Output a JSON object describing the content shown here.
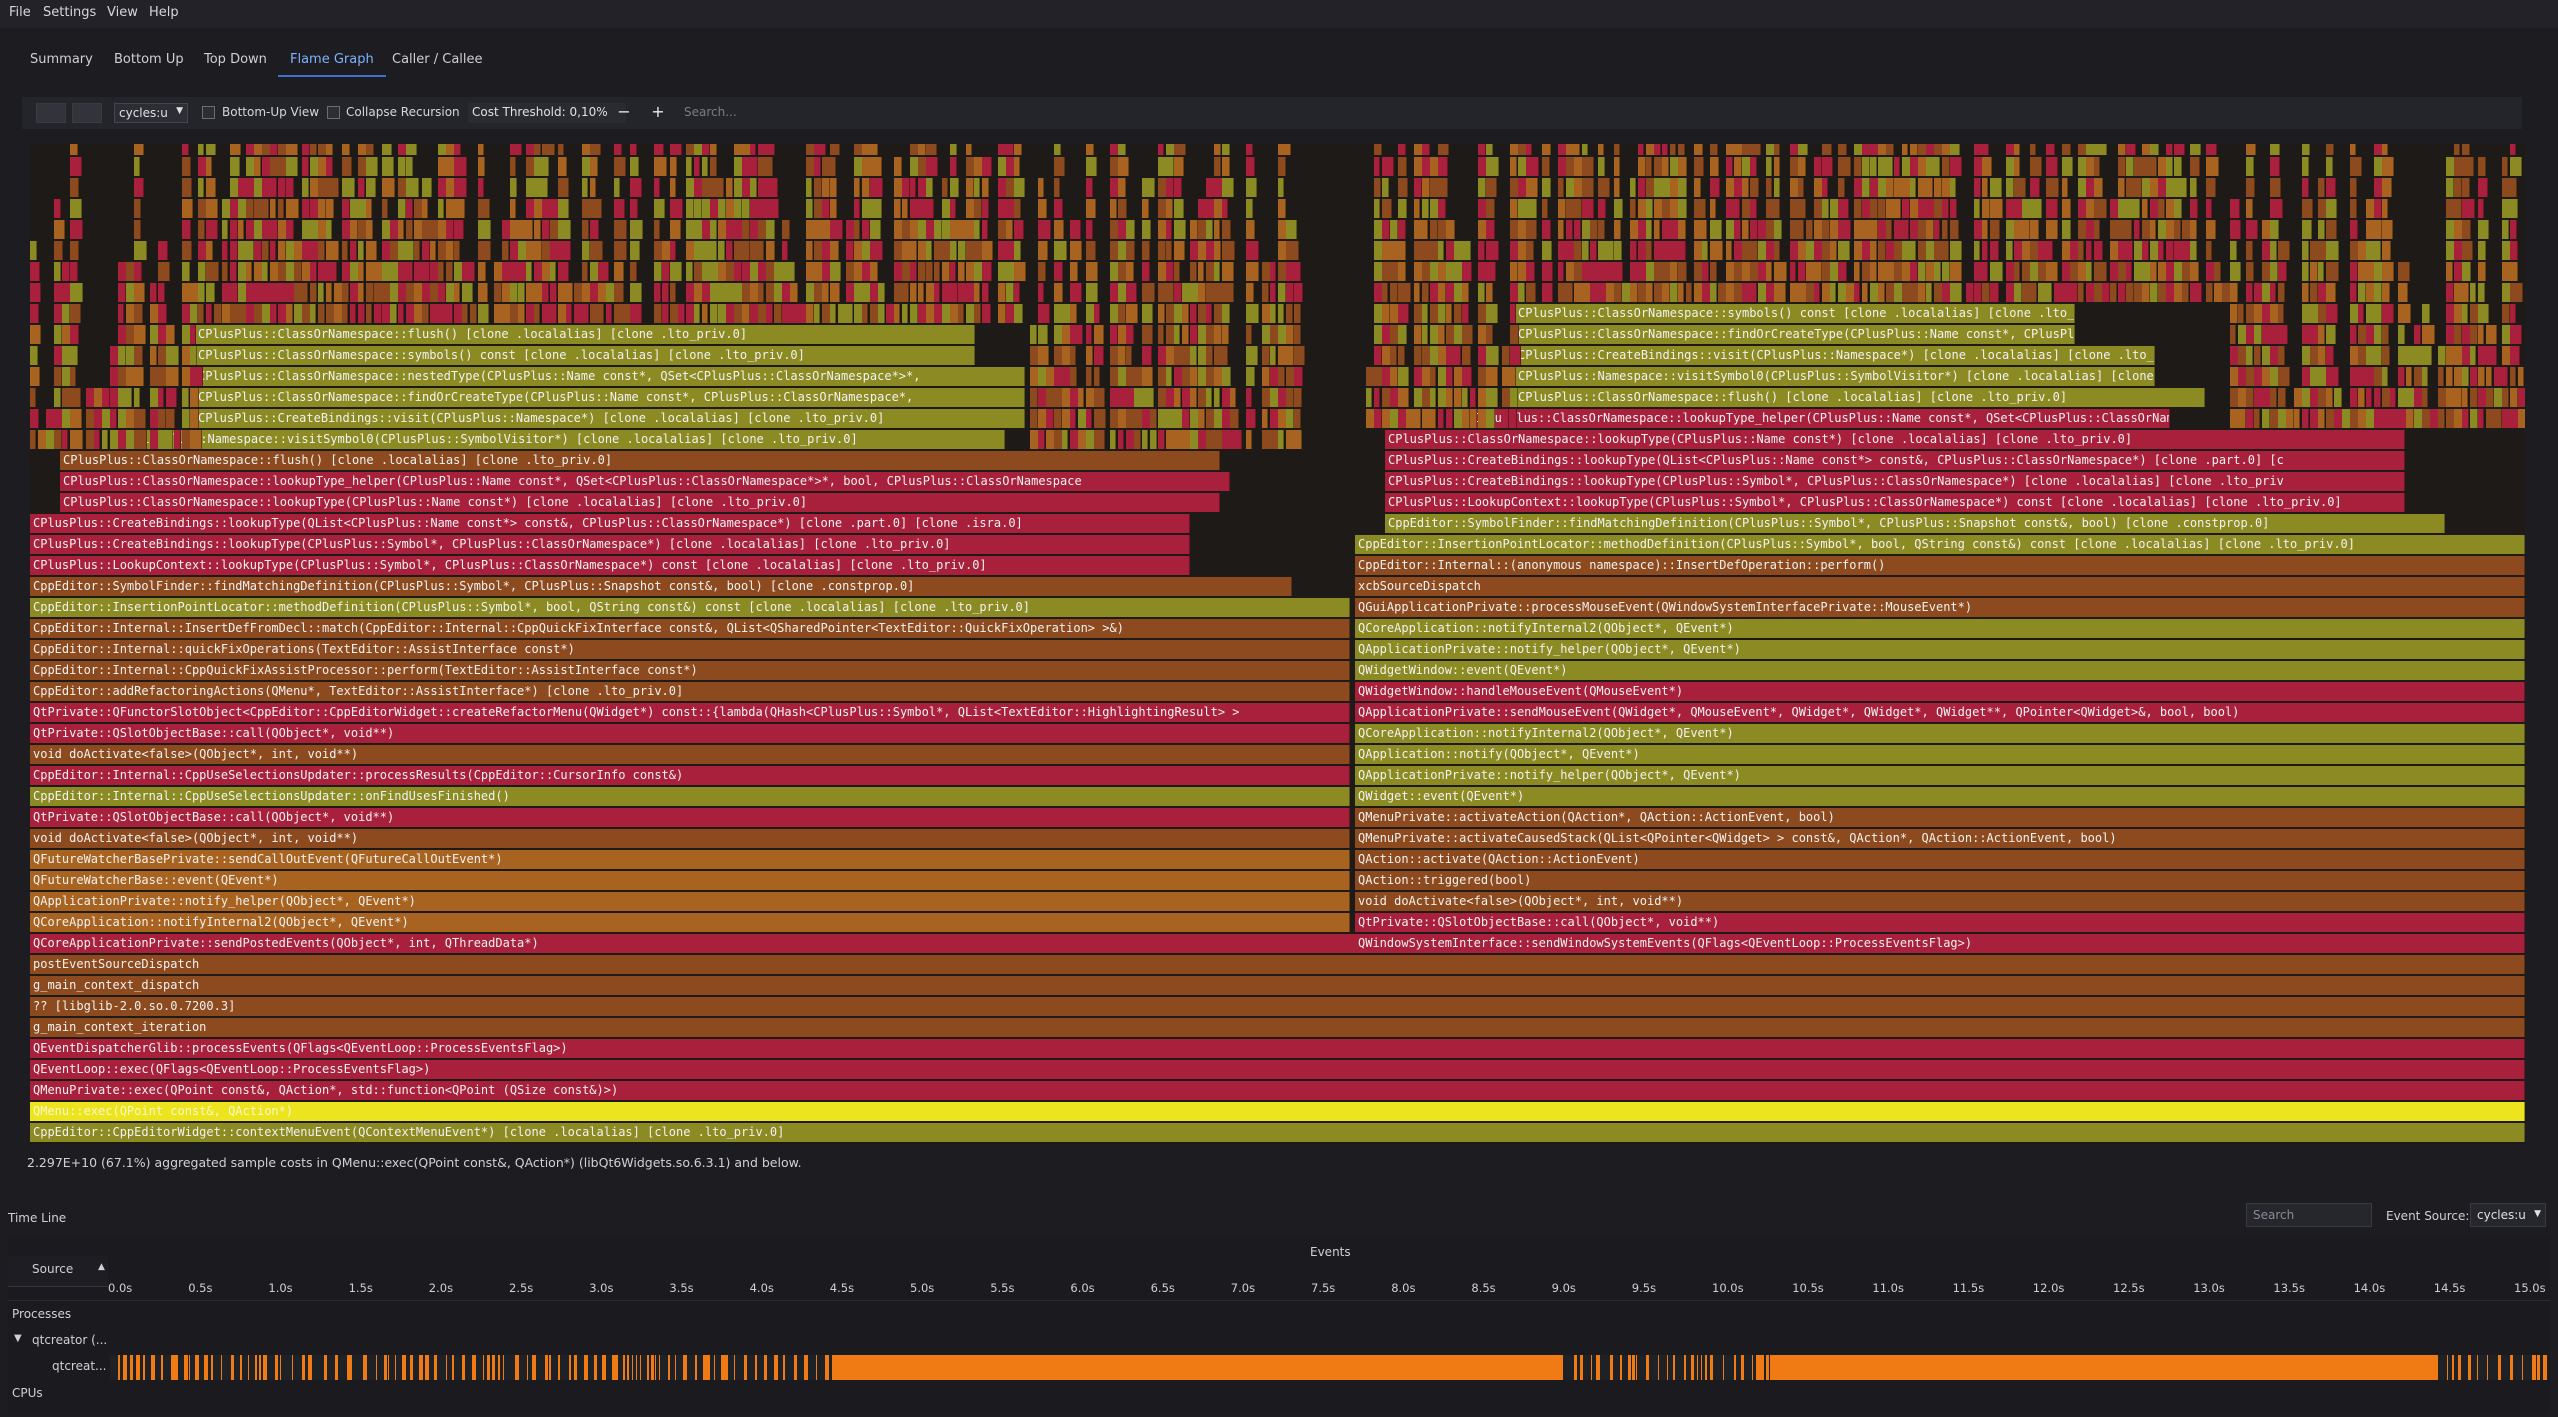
{
  "menu": [
    "File",
    "Settings",
    "View",
    "Help"
  ],
  "tabs": [
    {
      "label": "Summary",
      "active": false
    },
    {
      "label": "Bottom Up",
      "active": false
    },
    {
      "label": "Top Down",
      "active": false
    },
    {
      "label": "Flame Graph",
      "active": true
    },
    {
      "label": "Caller / Callee",
      "active": false
    }
  ],
  "toolbar": {
    "cost_source": "cycles:u",
    "bottom_up_label": "Bottom-Up View",
    "collapse_label": "Collapse Recursion",
    "threshold_label": "Cost Threshold: 0,10%",
    "minus": "−",
    "plus": "+",
    "search_placeholder": "Search..."
  },
  "colors": {
    "red": "#a8203b",
    "olive": "#8c8a22",
    "brown": "#8c4a1e",
    "orange": "#a86320",
    "selected": "#ece41e",
    "timeline_busy": "#f07a14"
  },
  "flame": {
    "frames": [
      {
        "text": "QMenu::exec(QPoint const&, QAction*)",
        "color": "sel",
        "selected": true
      },
      {
        "text": "CppEditor::CppEditorWidget::contextMenuEvent(QContextMenuEvent*) [clone .localalias] [clone .lto_priv.0]",
        "color": "olive"
      },
      {
        "text": "QMenuPrivate::exec(QPoint const&, QAction*, std::function<QPoint (QSize const&)>)",
        "color": "red"
      },
      {
        "text": "QEventLoop::exec(QFlags<QEventLoop::ProcessEventsFlag>)",
        "color": "red"
      },
      {
        "text": "QEventDispatcherGlib::processEvents(QFlags<QEventLoop::ProcessEventsFlag>)",
        "color": "red"
      },
      {
        "text": "g_main_context_iteration",
        "color": "brown"
      },
      {
        "text": "?? [libglib-2.0.so.0.7200.3]",
        "color": "brown"
      },
      {
        "text": "g_main_context_dispatch",
        "color": "brown"
      },
      {
        "text": "postEventSourceDispatch",
        "color": "brown"
      },
      {
        "text": "QCoreApplicationPrivate::sendPostedEvents(QObject*, int, QThreadData*)",
        "color": "red"
      },
      {
        "text": "QCoreApplication::notifyInternal2(QObject*, QEvent*)",
        "color": "orange"
      },
      {
        "text": "QApplicationPrivate::notify_helper(QObject*, QEvent*)",
        "color": "orange"
      },
      {
        "text": "QFutureWatcherBase::event(QEvent*)",
        "color": "orange"
      },
      {
        "text": "QFutureWatcherBasePrivate::sendCallOutEvent(QFutureCallOutEvent*)",
        "color": "orange"
      },
      {
        "text": "void doActivate<false>(QObject*, int, void**)",
        "color": "brown"
      },
      {
        "text": "QtPrivate::QSlotObjectBase::call(QObject*, void**)",
        "color": "red"
      },
      {
        "text": "CppEditor::Internal::CppUseSelectionsUpdater::onFindUsesFinished()",
        "color": "olive"
      },
      {
        "text": "CppEditor::Internal::CppUseSelectionsUpdater::processResults(CppEditor::CursorInfo const&)",
        "color": "red"
      },
      {
        "text": "void doActivate<false>(QObject*, int, void**)",
        "color": "brown"
      },
      {
        "text": "QtPrivate::QSlotObjectBase::call(QObject*, void**)",
        "color": "red"
      },
      {
        "text": "QtPrivate::QFunctorSlotObject<CppEditor::CppEditorWidget::createRefactorMenu(QWidget*) const::{lambda(QHash<CPlusPlus::Symbol*, QList<TextEditor::HighlightingResult> >",
        "color": "red"
      },
      {
        "text": "CppEditor::addRefactoringActions(QMenu*, TextEditor::AssistInterface*) [clone .lto_priv.0]",
        "color": "brown"
      },
      {
        "text": "CppEditor::Internal::CppQuickFixAssistProcessor::perform(TextEditor::AssistInterface const*)",
        "color": "brown"
      },
      {
        "text": "CppEditor::Internal::quickFixOperations(TextEditor::AssistInterface const*)",
        "color": "brown"
      },
      {
        "text": "CppEditor::Internal::InsertDefFromDecl::match(CppEditor::Internal::CppQuickFixInterface const&, QList<QSharedPointer<TextEditor::QuickFixOperation> >&)",
        "color": "brown"
      },
      {
        "text": "CppEditor::InsertionPointLocator::methodDefinition(CPlusPlus::Symbol*, bool, QString const&) const [clone .localalias] [clone .lto_priv.0]",
        "color": "olive"
      },
      {
        "text": "CppEditor::SymbolFinder::findMatchingDefinition(CPlusPlus::Symbol*, CPlusPlus::Snapshot const&, bool) [clone .constprop.0]",
        "color": "brown"
      },
      {
        "text": "CPlusPlus::LookupContext::lookupType(CPlusPlus::Symbol*, CPlusPlus::ClassOrNamespace*) const [clone .localalias] [clone .lto_priv.0]",
        "color": "red"
      },
      {
        "text": "CPlusPlus::CreateBindings::lookupType(CPlusPlus::Symbol*, CPlusPlus::ClassOrNamespace*) [clone .localalias] [clone .lto_priv.0]",
        "color": "red"
      },
      {
        "text": "CPlusPlus::CreateBindings::lookupType(QList<CPlusPlus::Name const*> const&, CPlusPlus::ClassOrNamespace*) [clone .part.0] [clone .isra.0]",
        "color": "red"
      },
      {
        "text": "CPlusPlus::ClassOrNamespace::lookupType(CPlusPlus::Name const*) [clone .localalias] [clone .lto_priv.0]",
        "color": "red"
      },
      {
        "text": "CPlusPlus::ClassOrNamespace::lookupType_helper(CPlusPlus::Name const*, QSet<CPlusPlus::ClassOrNamespace*>*, bool, CPlusPlus::ClassOrNamespace",
        "color": "red"
      },
      {
        "text": "CPlusPlus::ClassOrNamespace::flush() [clone .localalias] [clone .lto_priv.0]",
        "color": "brown"
      },
      {
        "text": "CPlusPlus::Namespace::visitSymbol0(CPlusPlus::SymbolVisitor*) [clone .localalias] [clone .lto_priv.0]",
        "color": "olive"
      },
      {
        "text": "CPlusPlus::CreateBindings::visit(CPlusPlus::Namespace*) [clone .localalias] [clone .lto_priv.0]",
        "color": "olive"
      },
      {
        "text": "CPlusPlus::ClassOrNamespace::findOrCreateType(CPlusPlus::Name const*, CPlusPlus::ClassOrNamespace*,",
        "color": "olive"
      },
      {
        "text": "CPlusPlus::ClassOrNamespace::nestedType(CPlusPlus::Name const*, QSet<CPlusPlus::ClassOrNamespace*>*,",
        "color": "olive"
      },
      {
        "text": "CPlusPlus::ClassOrNamespace::symbols() const [clone .localalias] [clone .lto_priv.0]",
        "color": "olive"
      },
      {
        "text": "CPlusPlus::ClassOrNamespace::flush() [clone .localalias] [clone .lto_priv.0]",
        "color": "olive"
      },
      {
        "text": "QtPrivate::QSlotObjectBase::call(QObject*, void**)",
        "color": "red"
      },
      {
        "text": "void doActivate<false>(QObject*, int, void**)",
        "color": "brown"
      },
      {
        "text": "QAction::triggered(bool)",
        "color": "brown"
      },
      {
        "text": "QAction::activate(QAction::ActionEvent)",
        "color": "brown"
      },
      {
        "text": "QMenuPrivate::activateCausedStack(QList<QPointer<QWidget> > const&, QAction*, QAction::ActionEvent, bool)",
        "color": "brown"
      },
      {
        "text": "QMenuPrivate::activateAction(QAction*, QAction::ActionEvent, bool)",
        "color": "brown"
      },
      {
        "text": "QWidget::event(QEvent*)",
        "color": "olive"
      },
      {
        "text": "QApplicationPrivate::notify_helper(QObject*, QEvent*)",
        "color": "olive"
      },
      {
        "text": "QApplication::notify(QObject*, QEvent*)",
        "color": "olive"
      },
      {
        "text": "QCoreApplication::notifyInternal2(QObject*, QEvent*)",
        "color": "olive"
      },
      {
        "text": "QApplicationPrivate::sendMouseEvent(QWidget*, QMouseEvent*, QWidget*, QWidget*, QWidget**, QPointer<QWidget>&, bool, bool)",
        "color": "red"
      },
      {
        "text": "QWidgetWindow::handleMouseEvent(QMouseEvent*)",
        "color": "red"
      },
      {
        "text": "QWidgetWindow::event(QEvent*)",
        "color": "olive"
      },
      {
        "text": "QApplicationPrivate::notify_helper(QObject*, QEvent*)",
        "color": "olive"
      },
      {
        "text": "QCoreApplication::notifyInternal2(QObject*, QEvent*)",
        "color": "olive"
      },
      {
        "text": "QGuiApplicationPrivate::processMouseEvent(QWindowSystemInterfacePrivate::MouseEvent*)",
        "color": "brown"
      },
      {
        "text": "QWindowSystemInterface::sendWindowSystemEvents(QFlags<QEventLoop::ProcessEventsFlag>)",
        "color": "red"
      },
      {
        "text": "xcbSourceDispatch",
        "color": "brown"
      },
      {
        "text": "CppEditor::Internal::(anonymous namespace)::InsertDefOperation::perform()",
        "color": "brown"
      },
      {
        "text": "CppEditor::InsertionPointLocator::methodDefinition(CPlusPlus::Symbol*, bool, QString const&) const [clone .localalias] [clone .lto_priv.0]",
        "color": "olive"
      },
      {
        "text": "CppEditor::SymbolFinder::findMatchingDefinition(CPlusPlus::Symbol*, CPlusPlus::Snapshot const&, bool) [clone .constprop.0]",
        "color": "olive"
      },
      {
        "text": "CPlusPlus::LookupContext::lookupType(CPlusPlus::Symbol*, CPlusPlus::ClassOrNamespace*) const [clone .localalias] [clone .lto_priv.0]",
        "color": "red"
      },
      {
        "text": "CPlusPlus::CreateBindings::lookupType(CPlusPlus::Symbol*, CPlusPlus::ClassOrNamespace*) [clone .localalias] [clone .lto_priv",
        "color": "red"
      },
      {
        "text": "CPlusPlus::CreateBindings::lookupType(QList<CPlusPlus::Name const*> const&, CPlusPlus::ClassOrNamespace*) [clone .part.0] [c",
        "color": "red"
      },
      {
        "text": "CPlusPlus::ClassOrNamespace::lookupType(CPlusPlus::Name const*) [clone .localalias] [clone .lto_priv.0]",
        "color": "red"
      },
      {
        "text": "CPlusPlus::ClassOrNamespace::lookupType_helper(CPlusPlus::Name const*, QSet<CPlusPlus::ClassOrNamespace*>*, bool, CPlusPlus::",
        "color": "red"
      },
      {
        "text": "CPlusPlus::ClassOrNamespace::flush() [clone .localalias] [clone .lto_priv.0]",
        "color": "olive"
      },
      {
        "text": "CPlusPlus::Namespace::visitSymbol0(CPlusPlus::SymbolVisitor*) [clone .localalias] [clone .lt",
        "color": "olive"
      },
      {
        "text": "CPlusPlus::CreateBindings::visit(CPlusPlus::Namespace*) [clone .localalias] [clone .lto_priv",
        "color": "olive"
      },
      {
        "text": "CPlusPlus::ClassOrNamespace::findOrCreateType(CPlusPlus::Name const*, CPlusPlus::ClassOrNam",
        "color": "olive"
      },
      {
        "text": "CPlusPlus::ClassOrNamespace::symbols() const [clone .localalias] [clone .lto_priv.0]",
        "color": "olive"
      },
      {
        "text": "CPlusPlus::ClassOrNamespace::flush() [clone .localalias] [clone .lto_priv.0]",
        "color": "olive"
      }
    ]
  },
  "summary": "2.297E+10 (67.1%) aggregated sample costs in QMenu::exec(QPoint const&, QAction*) (libQt6Widgets.so.6.3.1) and below.",
  "timeline": {
    "title": "Time Line",
    "search_placeholder": "Search",
    "event_source_label": "Event Source:",
    "event_source": "cycles:u",
    "events_label": "Events",
    "source_label": "Source",
    "ticks": [
      "0.0s",
      "0.5s",
      "1.0s",
      "1.5s",
      "2.0s",
      "2.5s",
      "3.0s",
      "3.5s",
      "4.0s",
      "4.5s",
      "5.0s",
      "5.5s",
      "6.0s",
      "6.5s",
      "7.0s",
      "7.5s",
      "8.0s",
      "8.5s",
      "9.0s",
      "9.5s",
      "10.0s",
      "10.5s",
      "11.0s",
      "11.5s",
      "12.0s",
      "12.5s",
      "13.0s",
      "13.5s",
      "14.0s",
      "14.5s",
      "15.0s"
    ],
    "rows": {
      "processes": "Processes",
      "process": "qtcreator (...",
      "thread": "qtcreat...",
      "cpus": "CPUs"
    },
    "busy_spans": [
      [
        4.5,
        9.05
      ],
      [
        10.35,
        14.5
      ]
    ]
  }
}
